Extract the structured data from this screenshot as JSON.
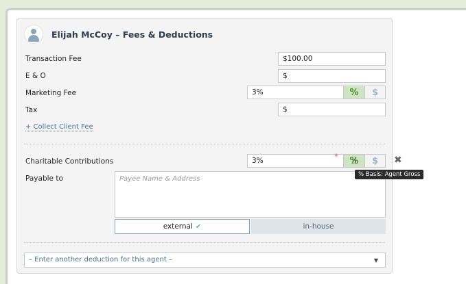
{
  "header": {
    "agent_name": "Elijah McCoy",
    "title": "Elijah McCoy – Fees & Deductions"
  },
  "fees": {
    "transaction_fee": {
      "label": "Transaction Fee",
      "value": "$100.00"
    },
    "eo": {
      "label": "E & O",
      "value": "$"
    },
    "marketing_fee": {
      "label": "Marketing Fee",
      "value": "3%",
      "percent_symbol": "%",
      "dollar_symbol": "$"
    },
    "tax": {
      "label": "Tax",
      "value": "$"
    }
  },
  "collect_client_fee_link": "+ Collect Client Fee",
  "charitable": {
    "label": "Charitable Contributions",
    "value": "3%",
    "required_marker": "*",
    "percent_symbol": "%",
    "dollar_symbol": "$",
    "tooltip": "% Basis: Agent Gross",
    "remove_symbol": "✖"
  },
  "payable": {
    "label": "Payable to",
    "placeholder": "Payee Name & Address",
    "external_label": "external",
    "check_symbol": "✔",
    "inhouse_label": "in-house"
  },
  "deduction_select": {
    "value": "– Enter another deduction for this agent –"
  },
  "icons": {
    "avatar": "user-icon",
    "remove": "close-icon",
    "dropdown": "chevron-down-icon",
    "cursor": "hand-pointer-icon"
  },
  "colors": {
    "accent_green": "#4e8f2a",
    "link_blue": "#4a6f95",
    "required_red": "#e36a6a"
  }
}
